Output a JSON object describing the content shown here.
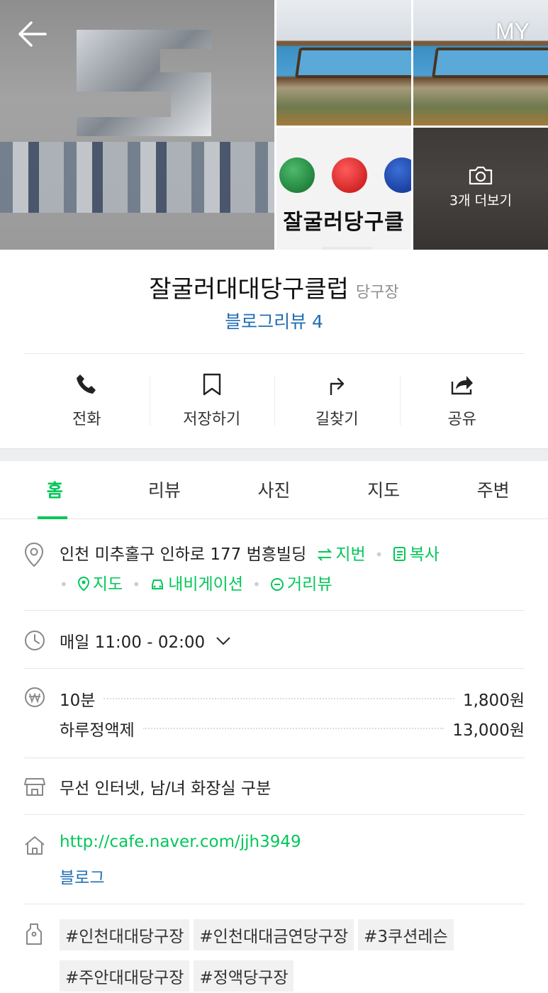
{
  "header": {
    "my_label": "MY",
    "more_photos_label": "3개 더보기",
    "photo_sign_text": "잘굴러당구클"
  },
  "place": {
    "name": "잘굴러대대당구클럽",
    "category": "당구장",
    "blog_review": "블로그리뷰 4"
  },
  "actions": [
    {
      "label": "전화",
      "icon": "phone-icon"
    },
    {
      "label": "저장하기",
      "icon": "bookmark-icon"
    },
    {
      "label": "길찾기",
      "icon": "directions-icon"
    },
    {
      "label": "공유",
      "icon": "share-icon"
    }
  ],
  "tabs": [
    {
      "label": "홈",
      "active": true
    },
    {
      "label": "리뷰",
      "active": false
    },
    {
      "label": "사진",
      "active": false
    },
    {
      "label": "지도",
      "active": false
    },
    {
      "label": "주변",
      "active": false
    }
  ],
  "address": {
    "text": "인천 미추홀구 인하로 177 범흥빌딩",
    "jibun": "지번",
    "copy": "복사",
    "map": "지도",
    "navigation": "내비게이션",
    "street_view": "거리뷰"
  },
  "hours": {
    "text": "매일 11:00 - 02:00"
  },
  "prices": [
    {
      "name": "10분",
      "price": "1,800원"
    },
    {
      "name": "하루정액제",
      "price": "13,000원"
    }
  ],
  "amenities": {
    "text": "무선 인터넷, 남/녀 화장실 구분"
  },
  "homepage": {
    "url": "http://cafe.naver.com/jjh3949",
    "blog": "블로그"
  },
  "tags": [
    "#인천대대당구장",
    "#인천대대금연당구장",
    "#3쿠션레슨",
    "#주안대대당구장",
    "#정액당구장"
  ],
  "colors": {
    "accent_green": "#03c75a",
    "link_blue": "#1f6db5"
  }
}
